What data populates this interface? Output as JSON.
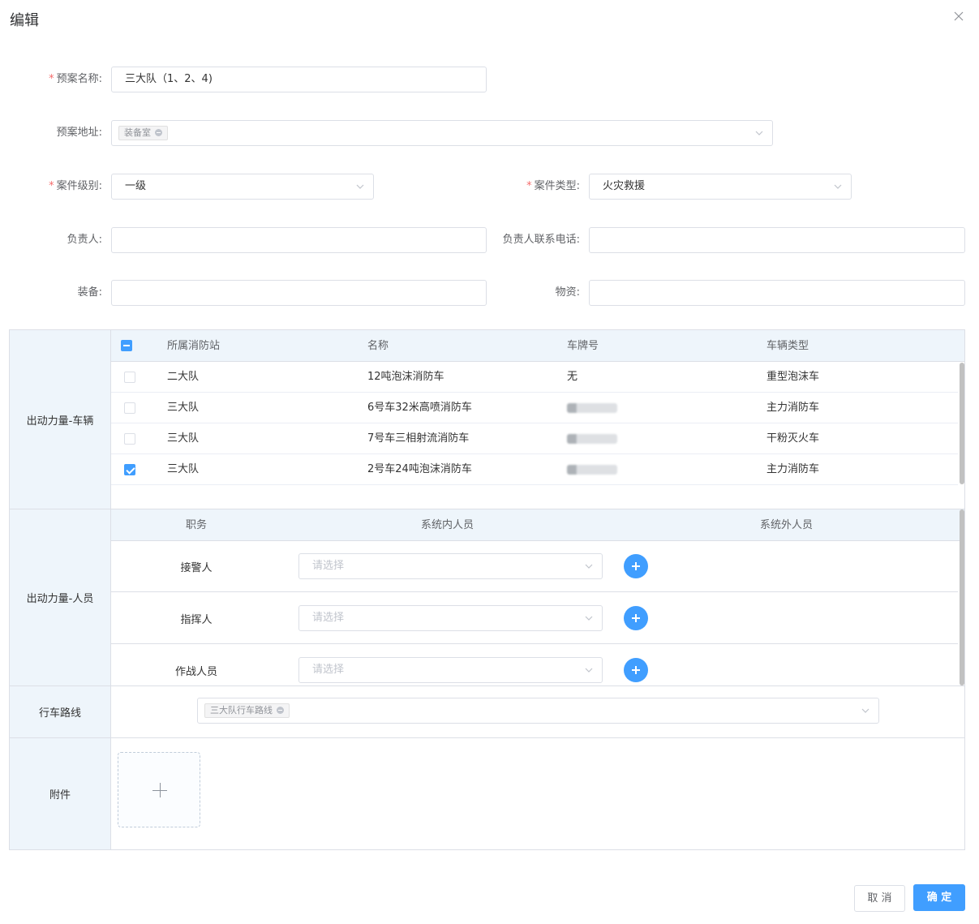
{
  "dialog": {
    "title": "编辑"
  },
  "form": {
    "name": {
      "label": "预案名称:",
      "required": true,
      "value": "三大队（1、2、4)"
    },
    "address": {
      "label": "预案地址:",
      "tags": [
        "装备室"
      ]
    },
    "level": {
      "label": "案件级别:",
      "required": true,
      "value": "一级"
    },
    "type": {
      "label": "案件类型:",
      "required": true,
      "value": "火灾救援"
    },
    "leader": {
      "label": "负责人:",
      "value": ""
    },
    "leader_phone": {
      "label": "负责人联系电话:",
      "value": ""
    },
    "equipment": {
      "label": "装备:",
      "value": ""
    },
    "materials": {
      "label": "物资:",
      "value": ""
    }
  },
  "vehicles": {
    "section_label": "出动力量-车辆",
    "columns": [
      "所属消防站",
      "名称",
      "车牌号",
      "车辆类型"
    ],
    "rows": [
      {
        "station": "二大队",
        "name": "12吨泡沫消防车",
        "plate": "无",
        "plate_blurred": false,
        "type": "重型泡沫车",
        "checked": false
      },
      {
        "station": "三大队",
        "name": "6号车32米高喷消防车",
        "plate": "",
        "plate_blurred": true,
        "type": "主力消防车",
        "checked": false
      },
      {
        "station": "三大队",
        "name": "7号车三相射流消防车",
        "plate": "",
        "plate_blurred": true,
        "type": "干粉灭火车",
        "checked": false
      },
      {
        "station": "三大队",
        "name": "2号车24吨泡沫消防车",
        "plate": "",
        "plate_blurred": true,
        "type": "主力消防车",
        "checked": true
      }
    ]
  },
  "personnel": {
    "section_label": "出动力量-人员",
    "columns": [
      "职务",
      "系统内人员",
      "系统外人员"
    ],
    "rows": [
      {
        "role": "接警人",
        "placeholder": "请选择"
      },
      {
        "role": "指挥人",
        "placeholder": "请选择"
      },
      {
        "role": "作战人员",
        "placeholder": "请选择"
      }
    ]
  },
  "route": {
    "section_label": "行车路线",
    "tags": [
      "三大队行车路线"
    ]
  },
  "attachment": {
    "section_label": "附件"
  },
  "footer": {
    "cancel": "取 消",
    "ok": "确 定"
  },
  "colors": {
    "primary": "#409eff",
    "required": "#f56c6c",
    "header_bg": "#eef5fb"
  }
}
